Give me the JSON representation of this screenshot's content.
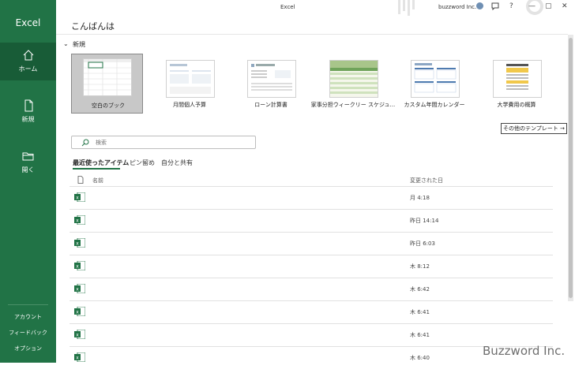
{
  "app": {
    "name": "Excel",
    "window_title": "Excel",
    "user_name": "buzzword Inc."
  },
  "window_controls": {
    "help": "?",
    "minimize": "—",
    "restore": "▢",
    "close": "✕"
  },
  "sidebar": {
    "items": [
      {
        "label": "ホーム",
        "icon": "home-icon"
      },
      {
        "label": "新規",
        "icon": "new-file-icon"
      },
      {
        "label": "開く",
        "icon": "folder-icon"
      }
    ],
    "bottom": [
      {
        "label": "アカウント"
      },
      {
        "label": "フィードバック"
      },
      {
        "label": "オプション"
      }
    ]
  },
  "main": {
    "greeting": "こんばんは",
    "new_section": {
      "label": "新規",
      "toggle": "⌄"
    },
    "templates": [
      {
        "label": "空白のブック"
      },
      {
        "label": "月間個人予算"
      },
      {
        "label": "ローン計算書"
      },
      {
        "label": "家事分担ウィークリー スケジュ..."
      },
      {
        "label": "カスタム年間カレンダー"
      },
      {
        "label": "大学費用の概算"
      }
    ],
    "more_templates": "その他のテンプレート →",
    "search": {
      "placeholder": "検索"
    },
    "tabs": [
      {
        "label": "最近使ったアイテム"
      },
      {
        "label": "ピン留め"
      },
      {
        "label": "自分と共有"
      }
    ],
    "columns": {
      "name": "名前",
      "modified": "変更された日"
    },
    "files": [
      {
        "modified": "月 4:18"
      },
      {
        "modified": "昨日 14:14"
      },
      {
        "modified": "昨日 6:03"
      },
      {
        "modified": "木 8:12"
      },
      {
        "modified": "木 6:42"
      },
      {
        "modified": "木 6:41"
      },
      {
        "modified": "木 6:41"
      },
      {
        "modified": "木 6:40"
      }
    ]
  },
  "watermark": "Buzzword Inc.",
  "colors": {
    "accent": "#217346",
    "accent_dark": "#185c37"
  }
}
